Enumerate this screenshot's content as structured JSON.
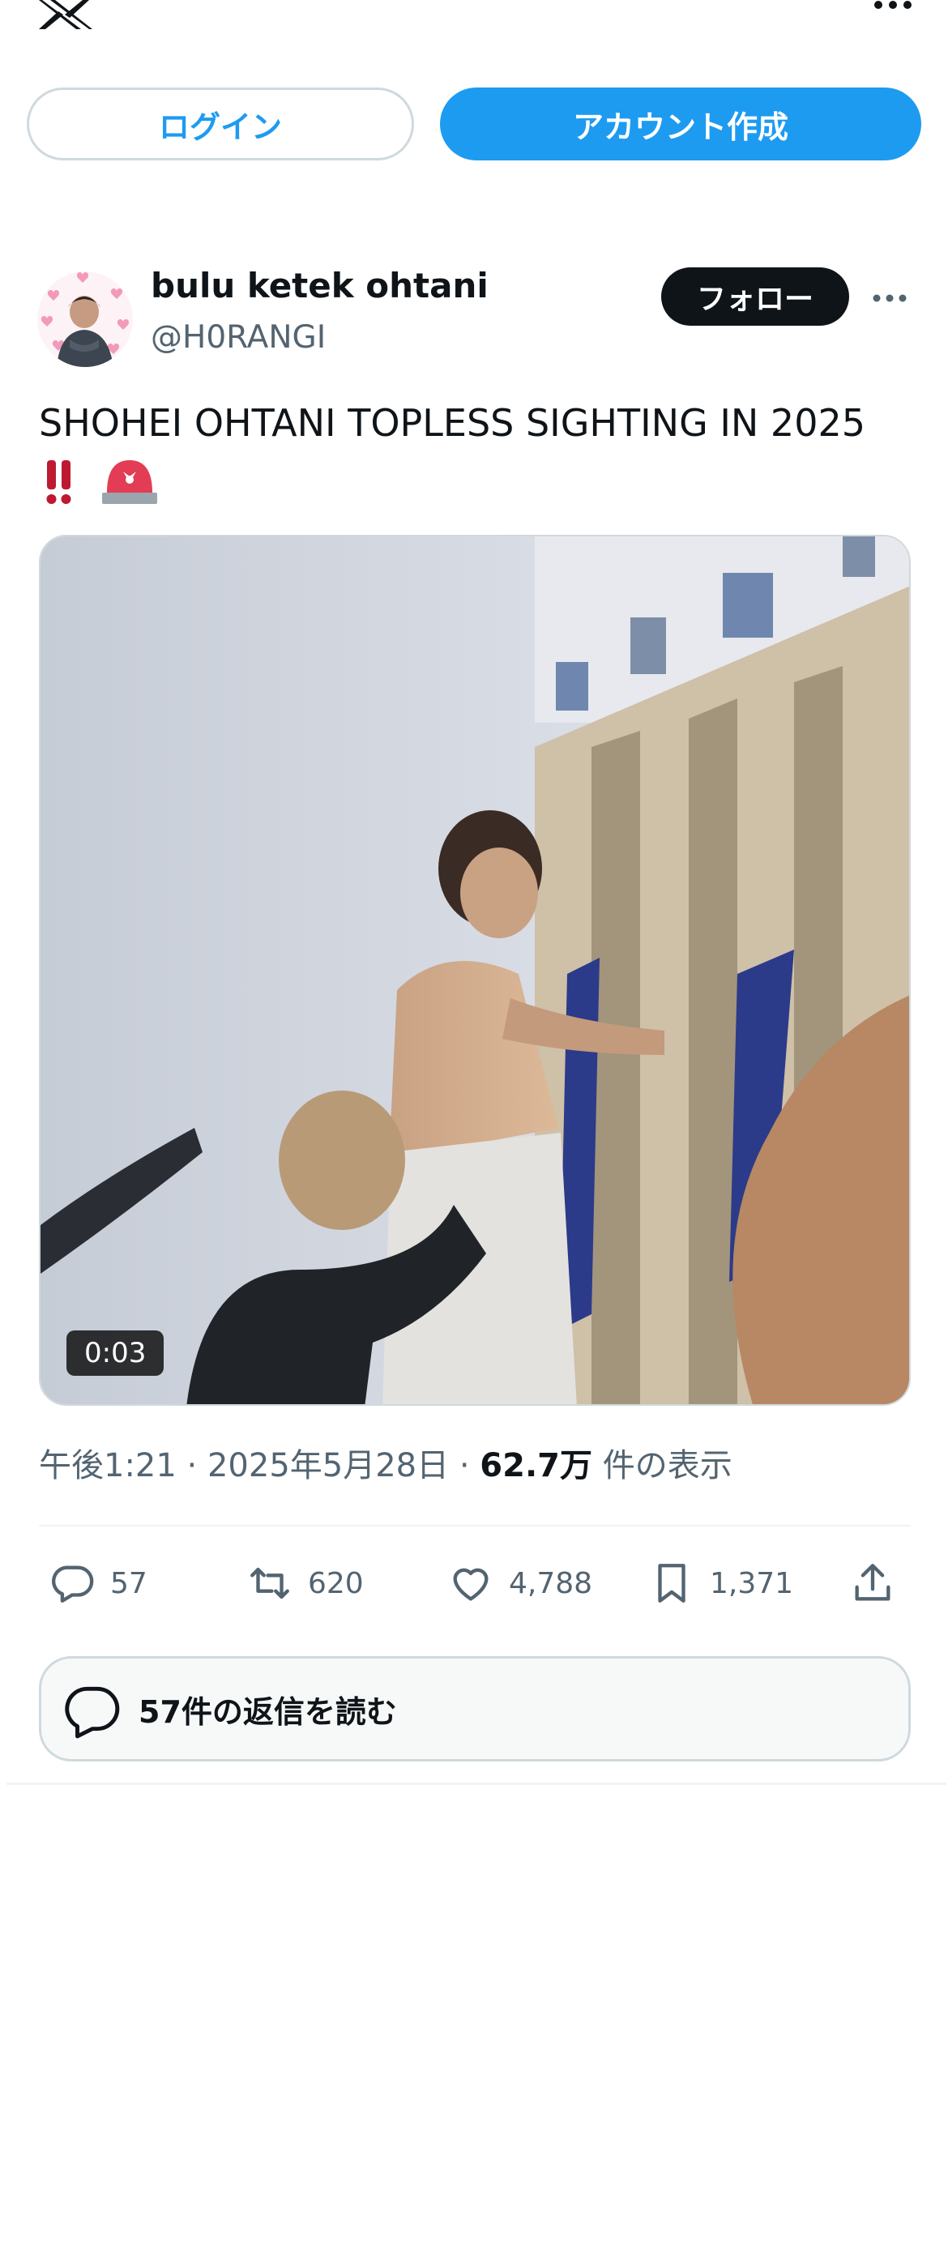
{
  "auth": {
    "login_label": "ログイン",
    "signup_label": "アカウント作成"
  },
  "tweet": {
    "author_name": "bulu ketek ohtani",
    "author_handle": "@H0RANGI",
    "follow_label": "フォロー",
    "text": "SHOHEI OHTANI TOPLESS SIGHTING IN 2025",
    "emojis": [
      "double-exclamation",
      "police-siren"
    ],
    "video_duration": "0:03",
    "time": "午後1:21",
    "date": "2025年5月28日",
    "views_count": "62.7万",
    "views_label": "件の表示",
    "stats": {
      "replies": "57",
      "reposts": "620",
      "likes": "4,788",
      "bookmarks": "1,371"
    },
    "read_replies_label": "57件の返信を読む"
  },
  "icons": [
    "x-logo-icon",
    "more-icon",
    "reply-icon",
    "repost-icon",
    "like-icon",
    "bookmark-icon",
    "share-icon",
    "speech-bubble-icon"
  ],
  "colors": {
    "accent": "#1d9bf0",
    "text": "#0f1419",
    "secondary": "#536471",
    "border": "#cfd9de"
  }
}
